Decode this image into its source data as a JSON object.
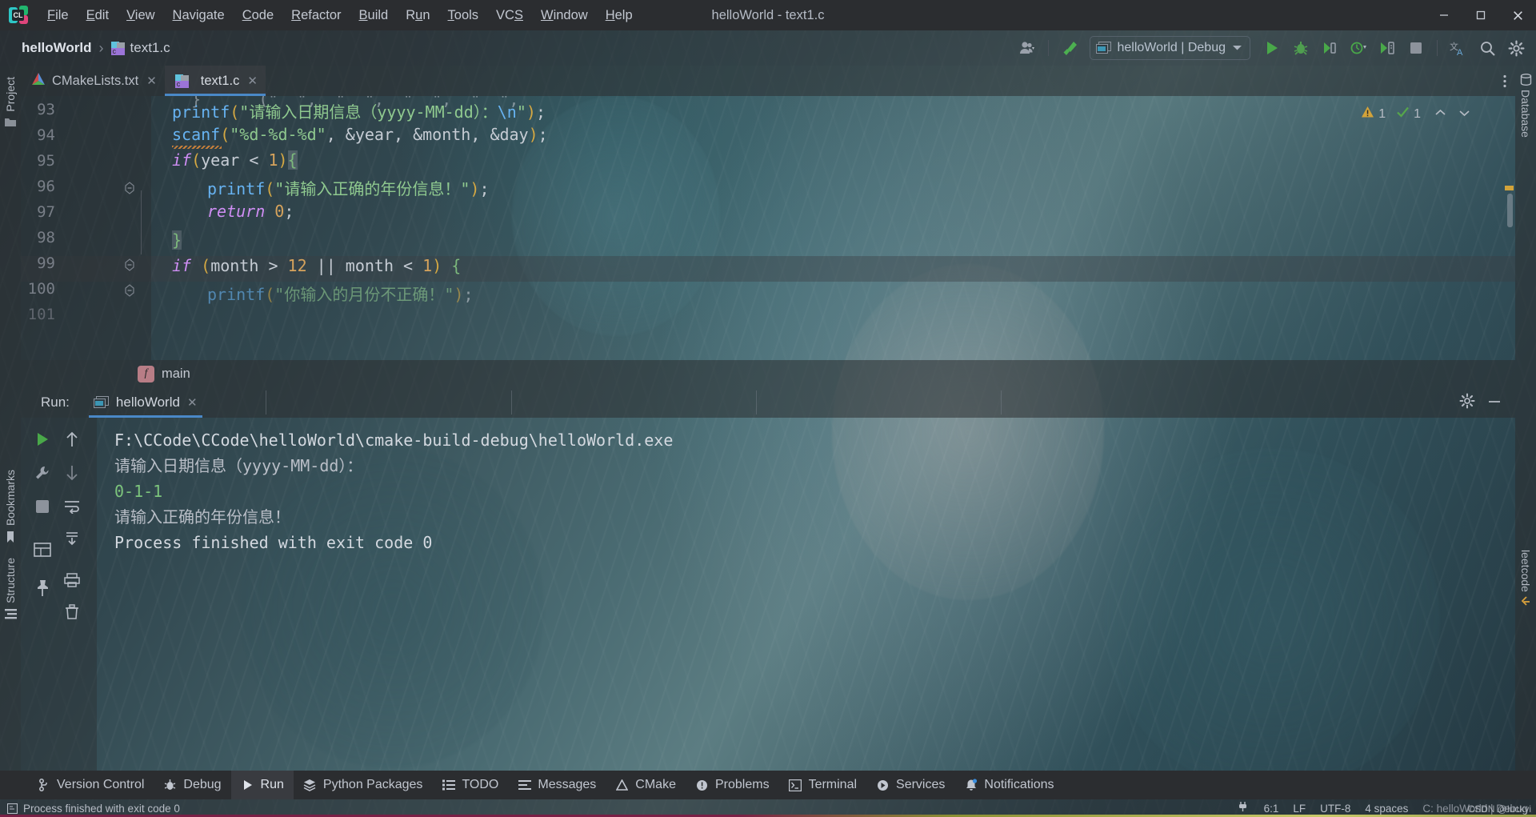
{
  "window": {
    "title": "helloWorld - text1.c",
    "app_icon": "clion-logo-icon",
    "minimize": "minimize-icon",
    "maximize": "maximize-icon",
    "close": "close-icon"
  },
  "menu": [
    {
      "label": "File",
      "mnemonic": "F"
    },
    {
      "label": "Edit",
      "mnemonic": "E"
    },
    {
      "label": "View",
      "mnemonic": "V"
    },
    {
      "label": "Navigate",
      "mnemonic": "N"
    },
    {
      "label": "Code",
      "mnemonic": "C"
    },
    {
      "label": "Refactor",
      "mnemonic": "R"
    },
    {
      "label": "Build",
      "mnemonic": "B"
    },
    {
      "label": "Run",
      "mnemonic": "u"
    },
    {
      "label": "Tools",
      "mnemonic": "T"
    },
    {
      "label": "VCS",
      "mnemonic": "S"
    },
    {
      "label": "Window",
      "mnemonic": "W"
    },
    {
      "label": "Help",
      "mnemonic": "H"
    }
  ],
  "toolbar": {
    "breadcrumb_project": "helloWorld",
    "breadcrumb_separator": "›",
    "breadcrumb_file": "text1.c",
    "run_config": "helloWorld | Debug",
    "icons": {
      "account": "user-account-icon",
      "build": "build-hammer-icon",
      "run": "run-icon",
      "debug": "debug-icon",
      "run_with_coverage": "run-coverage-icon",
      "profile": "profiler-icon",
      "attach": "attach-process-icon",
      "stop": "stop-icon",
      "translate": "translate-icon",
      "search": "search-everywhere-icon",
      "settings": "settings-gear-icon"
    }
  },
  "left_rail": [
    {
      "label": "Project",
      "icon": "project-icon"
    },
    {
      "label": "Bookmarks",
      "icon": "bookmarks-icon"
    },
    {
      "label": "Structure",
      "icon": "structure-icon"
    }
  ],
  "right_rail": [
    {
      "label": "Database",
      "icon": "database-icon"
    },
    {
      "label": "leetcode",
      "icon": "leetcode-icon"
    }
  ],
  "tabs": [
    {
      "label": "CMakeLists.txt",
      "icon": "cmake-icon",
      "active": false,
      "close": "close-tab-icon"
    },
    {
      "label": "text1.c",
      "icon": "c-file-icon",
      "active": true,
      "close": "close-tab-icon"
    }
  ],
  "tabs_more_icon": "more-vertical-icon",
  "editor": {
    "inspections": {
      "warning_count": "1",
      "ok_count": "1",
      "warning_icon": "warning-triangle-icon",
      "ok_icon": "checkmark-icon",
      "prev_icon": "chevron-up-icon",
      "next_icon": "chevron-down-icon"
    },
    "lines": [
      {
        "num": "93",
        "partial": true,
        "segments": [
          {
            "t": "  }",
            "c": "op"
          }
        ]
      },
      {
        "num": "94",
        "segments": [
          {
            "t": "printf",
            "c": "fn"
          },
          {
            "t": "(",
            "c": "pun"
          },
          {
            "t": "\"请输入日期信息（yyyy-MM-dd）：",
            "c": "str"
          },
          {
            "t": "\\n",
            "c": "esc"
          },
          {
            "t": "\"",
            "c": "str"
          },
          {
            "t": ")",
            "c": "pun"
          },
          {
            "t": ";",
            "c": "op"
          }
        ]
      },
      {
        "num": "95",
        "segments": [
          {
            "t": "scanf",
            "c": "fn"
          },
          {
            "t": "(",
            "c": "pun"
          },
          {
            "t": "\"%d-%d-%d\"",
            "c": "str"
          },
          {
            "t": ", ",
            "c": "op"
          },
          {
            "t": "&year",
            "c": "id"
          },
          {
            "t": ", ",
            "c": "op"
          },
          {
            "t": "&month",
            "c": "id"
          },
          {
            "t": ", ",
            "c": "op"
          },
          {
            "t": "&day",
            "c": "id"
          },
          {
            "t": ")",
            "c": "pun"
          },
          {
            "t": ";",
            "c": "op"
          }
        ]
      },
      {
        "num": "96",
        "fold": "fold-collapse-icon",
        "segments": [
          {
            "t": "if",
            "c": "kw"
          },
          {
            "t": "(",
            "c": "pun"
          },
          {
            "t": "year ",
            "c": "id"
          },
          {
            "t": "< ",
            "c": "op"
          },
          {
            "t": "1",
            "c": "num"
          },
          {
            "t": ")",
            "c": "pun"
          },
          {
            "t": "{",
            "c": "green-brace"
          }
        ]
      },
      {
        "num": "97",
        "indent": 3,
        "segments": [
          {
            "t": "printf",
            "c": "fn"
          },
          {
            "t": "(",
            "c": "pun"
          },
          {
            "t": "\"请输入正确的年份信息！\"",
            "c": "str"
          },
          {
            "t": ")",
            "c": "pun"
          },
          {
            "t": ";",
            "c": "op"
          }
        ]
      },
      {
        "num": "98",
        "indent": 3,
        "segments": [
          {
            "t": "return",
            "c": "kw"
          },
          {
            "t": " ",
            "c": "op"
          },
          {
            "t": "0",
            "c": "num"
          },
          {
            "t": ";",
            "c": "op"
          }
        ]
      },
      {
        "num": "99",
        "current": true,
        "fold": "fold-end-icon",
        "segments": [
          {
            "t": "}",
            "c": "green-brace"
          }
        ]
      },
      {
        "num": "100",
        "fold": "fold-collapse-icon",
        "segments": [
          {
            "t": "if",
            "c": "kw"
          },
          {
            "t": " (",
            "c": "pun"
          },
          {
            "t": "month ",
            "c": "id"
          },
          {
            "t": "> ",
            "c": "op"
          },
          {
            "t": "12",
            "c": "num"
          },
          {
            "t": " || ",
            "c": "op"
          },
          {
            "t": "month ",
            "c": "id"
          },
          {
            "t": "< ",
            "c": "op"
          },
          {
            "t": "1",
            "c": "num"
          },
          {
            "t": ") ",
            "c": "pun"
          },
          {
            "t": "{",
            "c": "green-brace"
          }
        ]
      },
      {
        "num": "101",
        "indent": 3,
        "clipped": true,
        "segments": [
          {
            "t": "printf",
            "c": "fn"
          },
          {
            "t": "(",
            "c": "pun"
          },
          {
            "t": "\"你输入的月份不正确！\"",
            "c": "str"
          },
          {
            "t": ")",
            "c": "pun"
          },
          {
            "t": ";",
            "c": "op"
          }
        ]
      }
    ]
  },
  "crumbstrip": {
    "badge": "f",
    "label": "main"
  },
  "run_window": {
    "label": "Run:",
    "tab": "helloWorld",
    "tab_icon": "run-config-icon",
    "close_icon": "close-tab-icon",
    "settings_icon": "settings-gear-icon",
    "hide_icon": "minimize-window-icon",
    "side_icons": [
      "rerun-icon",
      "scroll-up-icon",
      "wrench-icon",
      "scroll-down-icon",
      "stop-icon",
      "soft-wrap-icon",
      "scroll-to-end-icon",
      "print-table-icon",
      "print-icon",
      "pin-icon",
      "clear-all-icon"
    ],
    "console": [
      {
        "text": "F:\\CCode\\CCode\\helloWorld\\cmake-build-debug\\helloWorld.exe",
        "style": "c-white"
      },
      {
        "text": "请输入日期信息（yyyy-MM-dd）：",
        "style": "c-grey"
      },
      {
        "text": "0-1-1",
        "style": "c-green"
      },
      {
        "text": "请输入正确的年份信息！",
        "style": "c-grey"
      },
      {
        "text": "Process finished with exit code 0",
        "style": "c-white"
      }
    ]
  },
  "bottom_bar": [
    {
      "label": "Version Control",
      "icon": "branch-icon",
      "active": false
    },
    {
      "label": "Debug",
      "icon": "debug-bug-icon",
      "active": false
    },
    {
      "label": "Run",
      "icon": "run-triangle-icon",
      "active": true
    },
    {
      "label": "Python Packages",
      "icon": "packages-icon",
      "active": false
    },
    {
      "label": "TODO",
      "icon": "todo-list-icon",
      "active": false
    },
    {
      "label": "Messages",
      "icon": "messages-icon",
      "active": false
    },
    {
      "label": "CMake",
      "icon": "cmake-triangle-icon",
      "active": false
    },
    {
      "label": "Problems",
      "icon": "problems-icon",
      "active": false
    },
    {
      "label": "Terminal",
      "icon": "terminal-icon",
      "active": false
    },
    {
      "label": "Services",
      "icon": "services-icon",
      "active": false
    },
    {
      "label": "Notifications",
      "icon": "notifications-bell-icon",
      "active": false
    }
  ],
  "status_bar": {
    "message": "Process finished with exit code 0",
    "message_icon": "console-icon",
    "plug_icon": "plugin-icon",
    "caret": "6:1",
    "line_separator": "LF",
    "encoding": "UTF-8",
    "indent": "4 spaces",
    "context": "C: helloWorld | Debug",
    "watermark": "CSDN @luckyi"
  },
  "colors": {
    "accent_blue": "#4a88c7",
    "run_green": "#49a849",
    "warning_orange": "#d3a33a",
    "string_green": "#8fc98f",
    "keyword_purple": "#cf8ef4",
    "number_orange": "#d6a35c"
  }
}
